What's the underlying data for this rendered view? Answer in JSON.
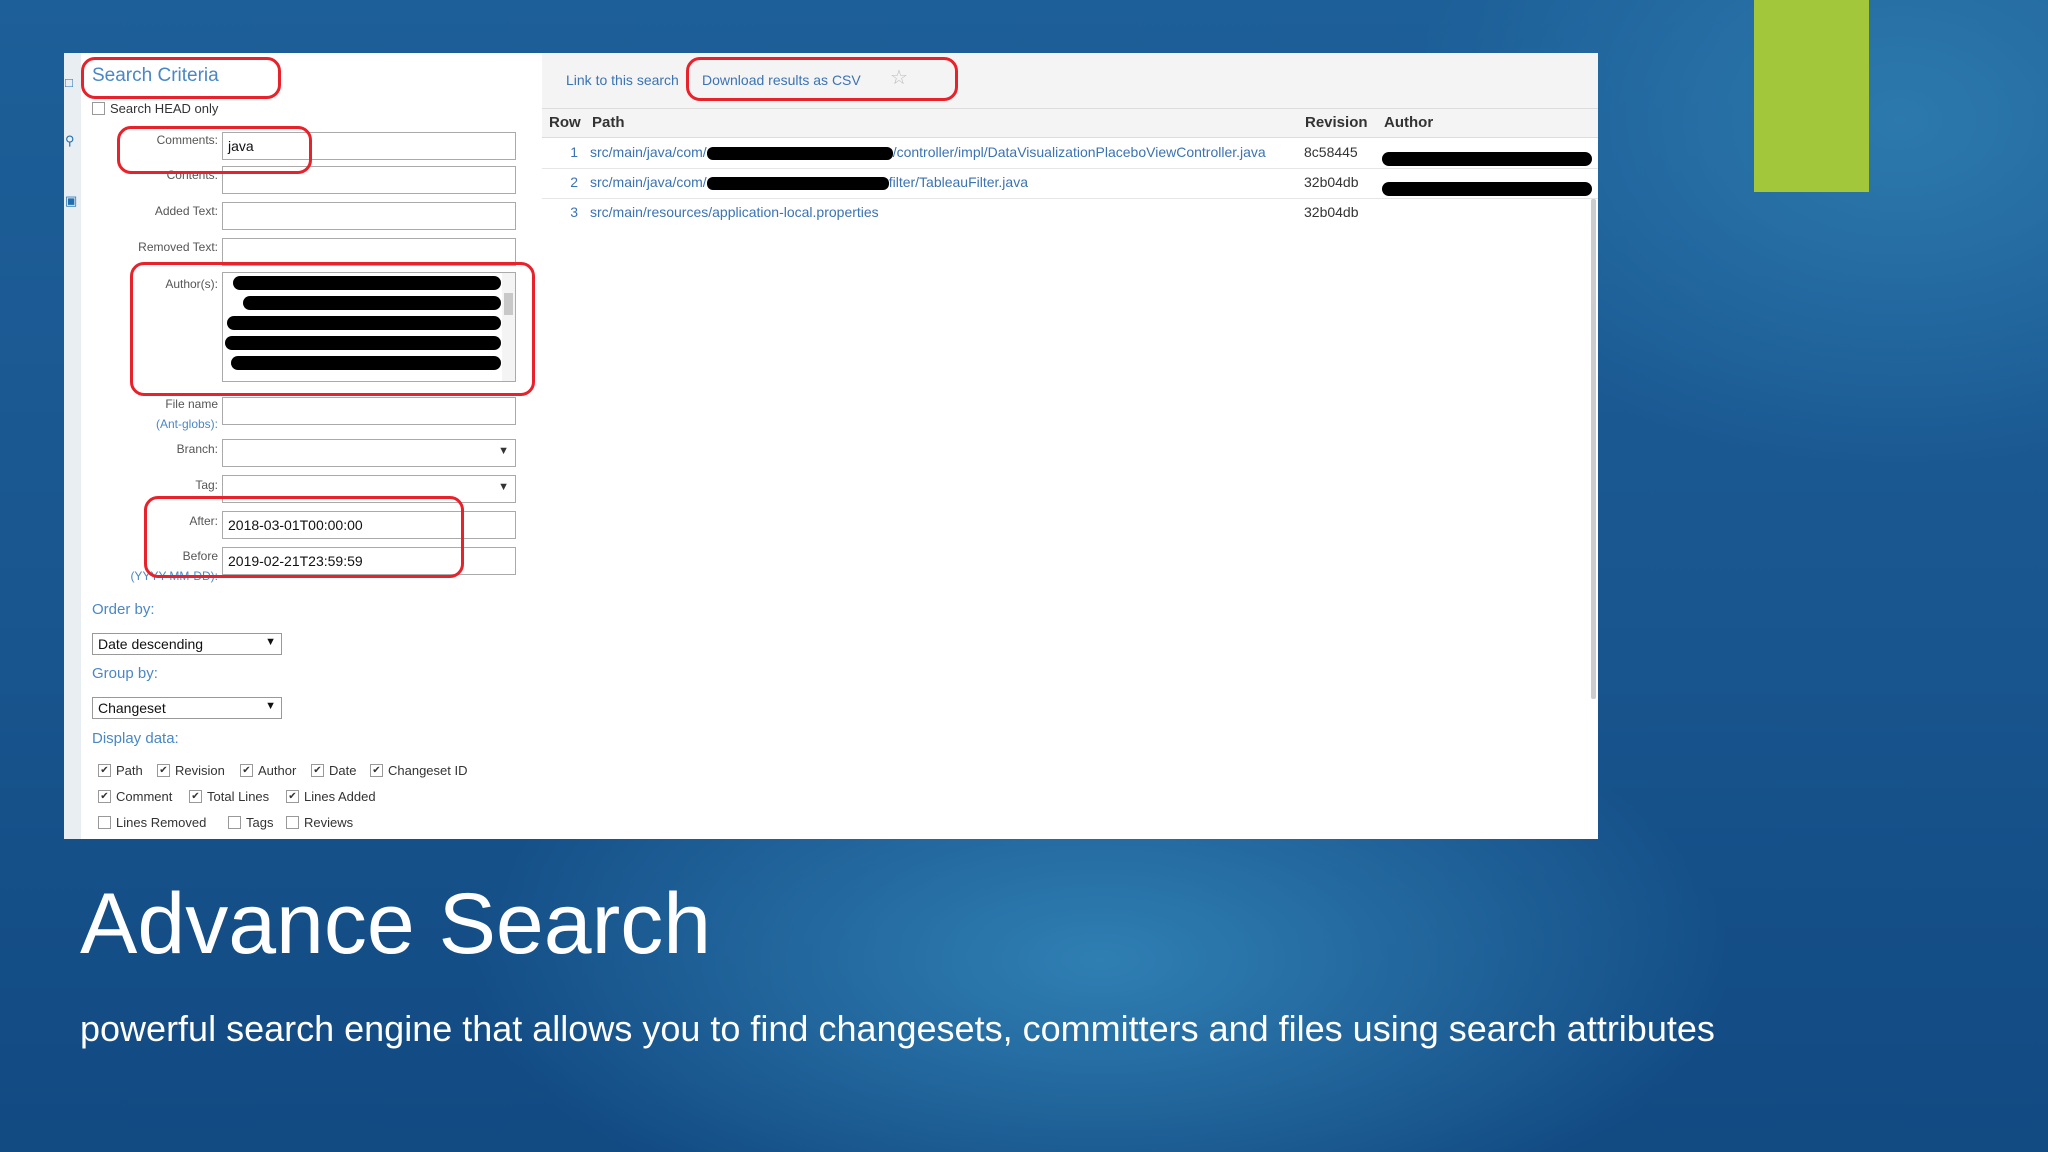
{
  "slide": {
    "title": "Advance Search",
    "subtitle": "powerful search engine that allows you to find changesets, committers and files using search attributes"
  },
  "criteria": {
    "title": "Search Criteria",
    "search_head_only": "Search HEAD only",
    "comments_label": "Comments:",
    "comments_value": "java",
    "contents_label": "Contents:",
    "added_text_label": "Added Text:",
    "removed_text_label": "Removed Text:",
    "authors_label": "Author(s):",
    "file_name_label": "File name",
    "ant_globs_label": "(Ant-globs):",
    "branch_label": "Branch:",
    "tag_label": "Tag:",
    "after_label": "After:",
    "after_value": "2018-03-01T00:00:00",
    "before_label": "Before",
    "before_value": "2019-02-21T23:59:59",
    "date_format_hint": "(YYYY-MM-DD):",
    "order_by_label": "Order by:",
    "order_by_value": "Date descending",
    "group_by_label": "Group by:",
    "group_by_value": "Changeset",
    "display_data_label": "Display data:",
    "display_options": [
      {
        "label": "Path",
        "checked": true
      },
      {
        "label": "Revision",
        "checked": true
      },
      {
        "label": "Author",
        "checked": true
      },
      {
        "label": "Date",
        "checked": true
      },
      {
        "label": "Changeset ID",
        "checked": true
      },
      {
        "label": "Comment",
        "checked": true
      },
      {
        "label": "Total Lines",
        "checked": true
      },
      {
        "label": "Lines Added",
        "checked": true
      },
      {
        "label": "Lines Removed",
        "checked": false
      },
      {
        "label": "Tags",
        "checked": false
      },
      {
        "label": "Reviews",
        "checked": false
      }
    ]
  },
  "results": {
    "link_label": "Link to this search",
    "download_label": "Download results as CSV",
    "columns": [
      "Row",
      "Path",
      "Revision",
      "Author"
    ],
    "rows": [
      {
        "row": "1",
        "path_start": "src/main/java/com/",
        "path_end": "/controller/impl/DataVisualizationPlaceboViewController.java",
        "revision": "8c58445"
      },
      {
        "row": "2",
        "path_start": "src/main/java/com/",
        "path_end": "filter/TableauFilter.java",
        "revision": "32b04db"
      },
      {
        "row": "3",
        "path_start": "src/main/resources/application-local.properties",
        "path_end": "",
        "revision": "32b04db"
      }
    ]
  }
}
